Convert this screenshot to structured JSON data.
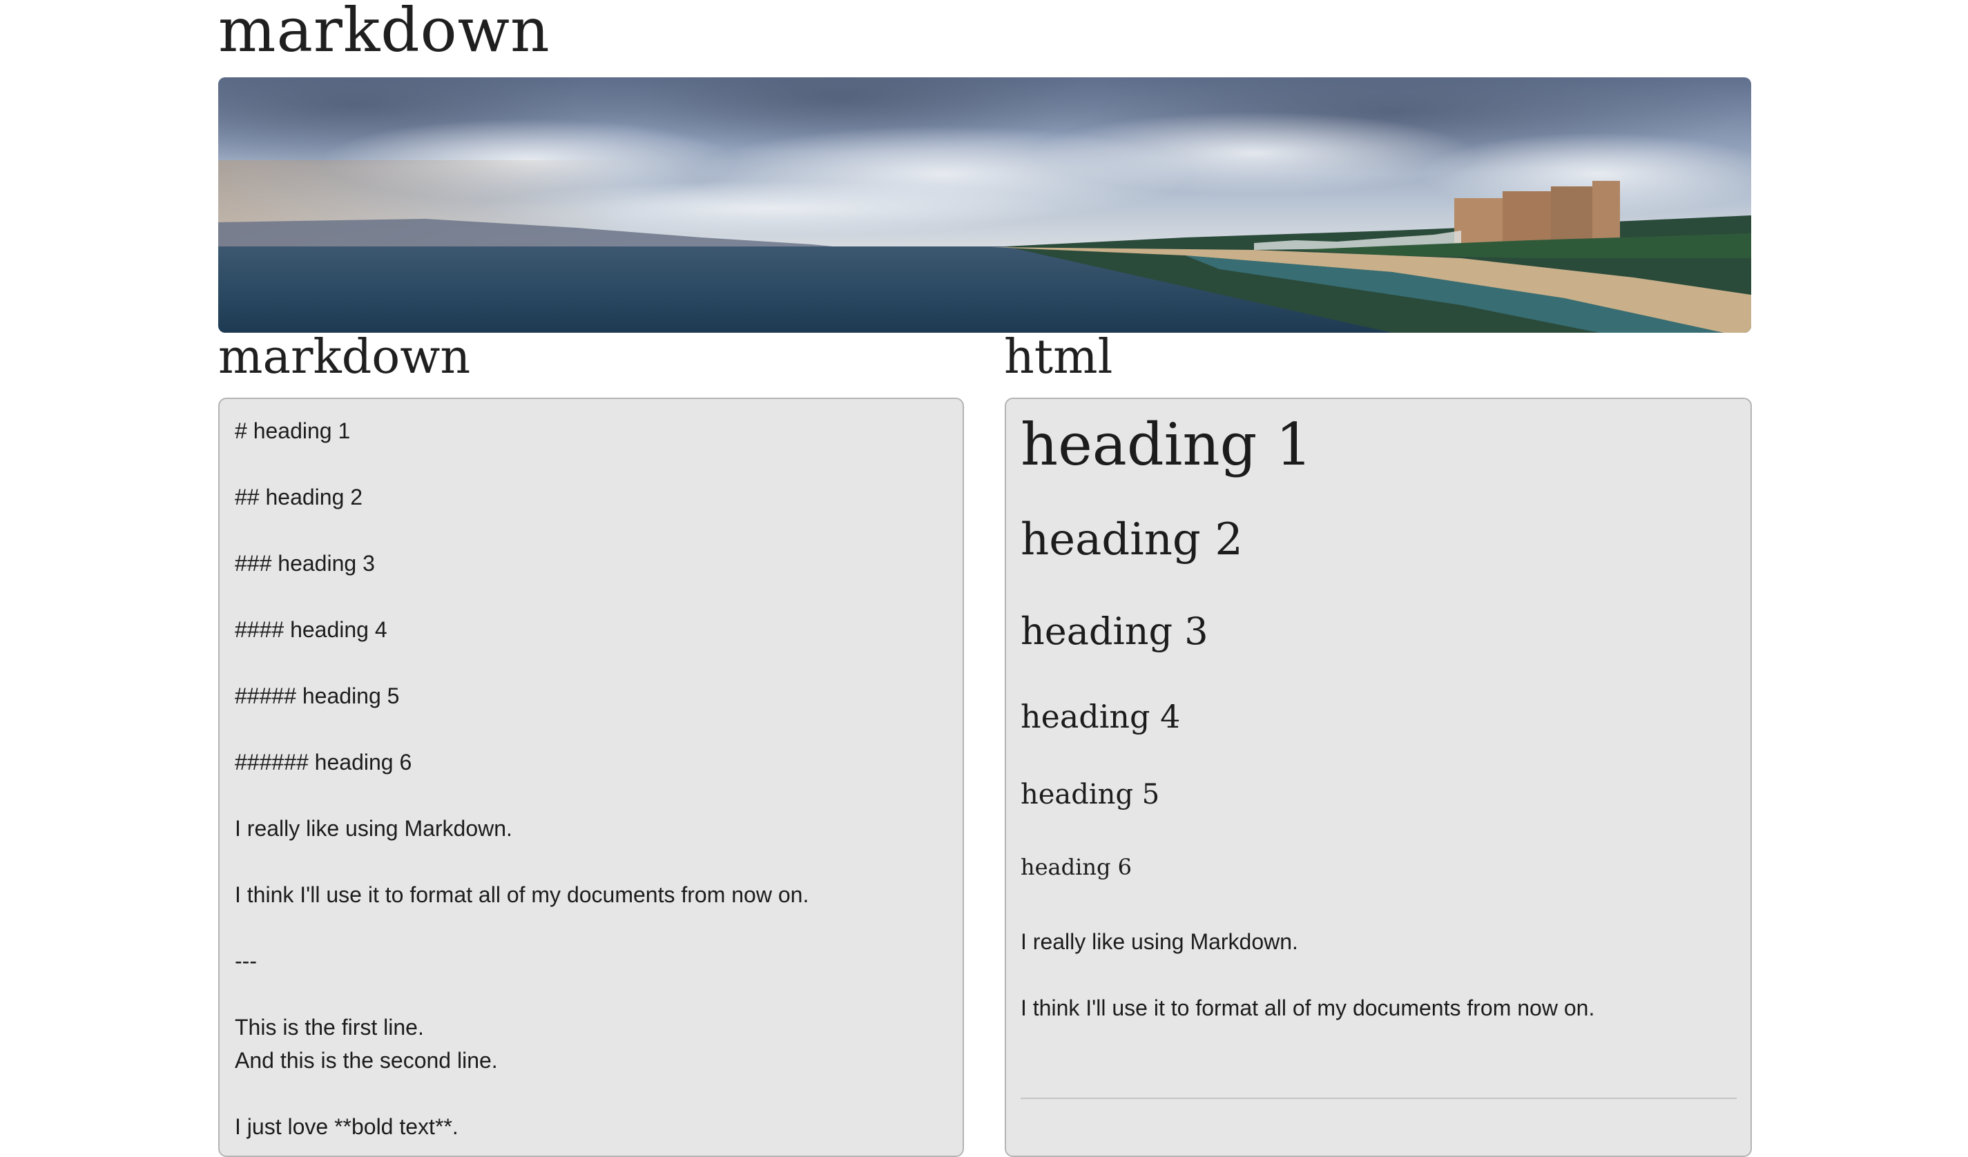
{
  "header": {
    "site_title": "markdown"
  },
  "banner": {
    "icon": "ocean-beach-panorama-image"
  },
  "left_column": {
    "title": "markdown",
    "lines": [
      "# heading 1",
      "",
      "## heading 2",
      "",
      "### heading 3",
      "",
      "#### heading 4",
      "",
      "##### heading 5",
      "",
      "###### heading 6",
      "",
      "I really like using Markdown.",
      "",
      "I think I'll use it to format all of my documents from now on.",
      "",
      "---",
      "",
      "This is the first line.",
      "And this is the second line.",
      "",
      "I just love **bold text**."
    ]
  },
  "right_column": {
    "title": "html",
    "h1": "heading 1",
    "h2": "heading 2",
    "h3": "heading 3",
    "h4": "heading 4",
    "h5": "heading 5",
    "h6": "heading 6",
    "p1": "I really like using Markdown.",
    "p2": "I think I'll use it to format all of my documents from now on."
  },
  "colors": {
    "pane_background": "#e6e6e6",
    "pane_border": "#b4b4b4",
    "text": "#1f1f1f"
  }
}
